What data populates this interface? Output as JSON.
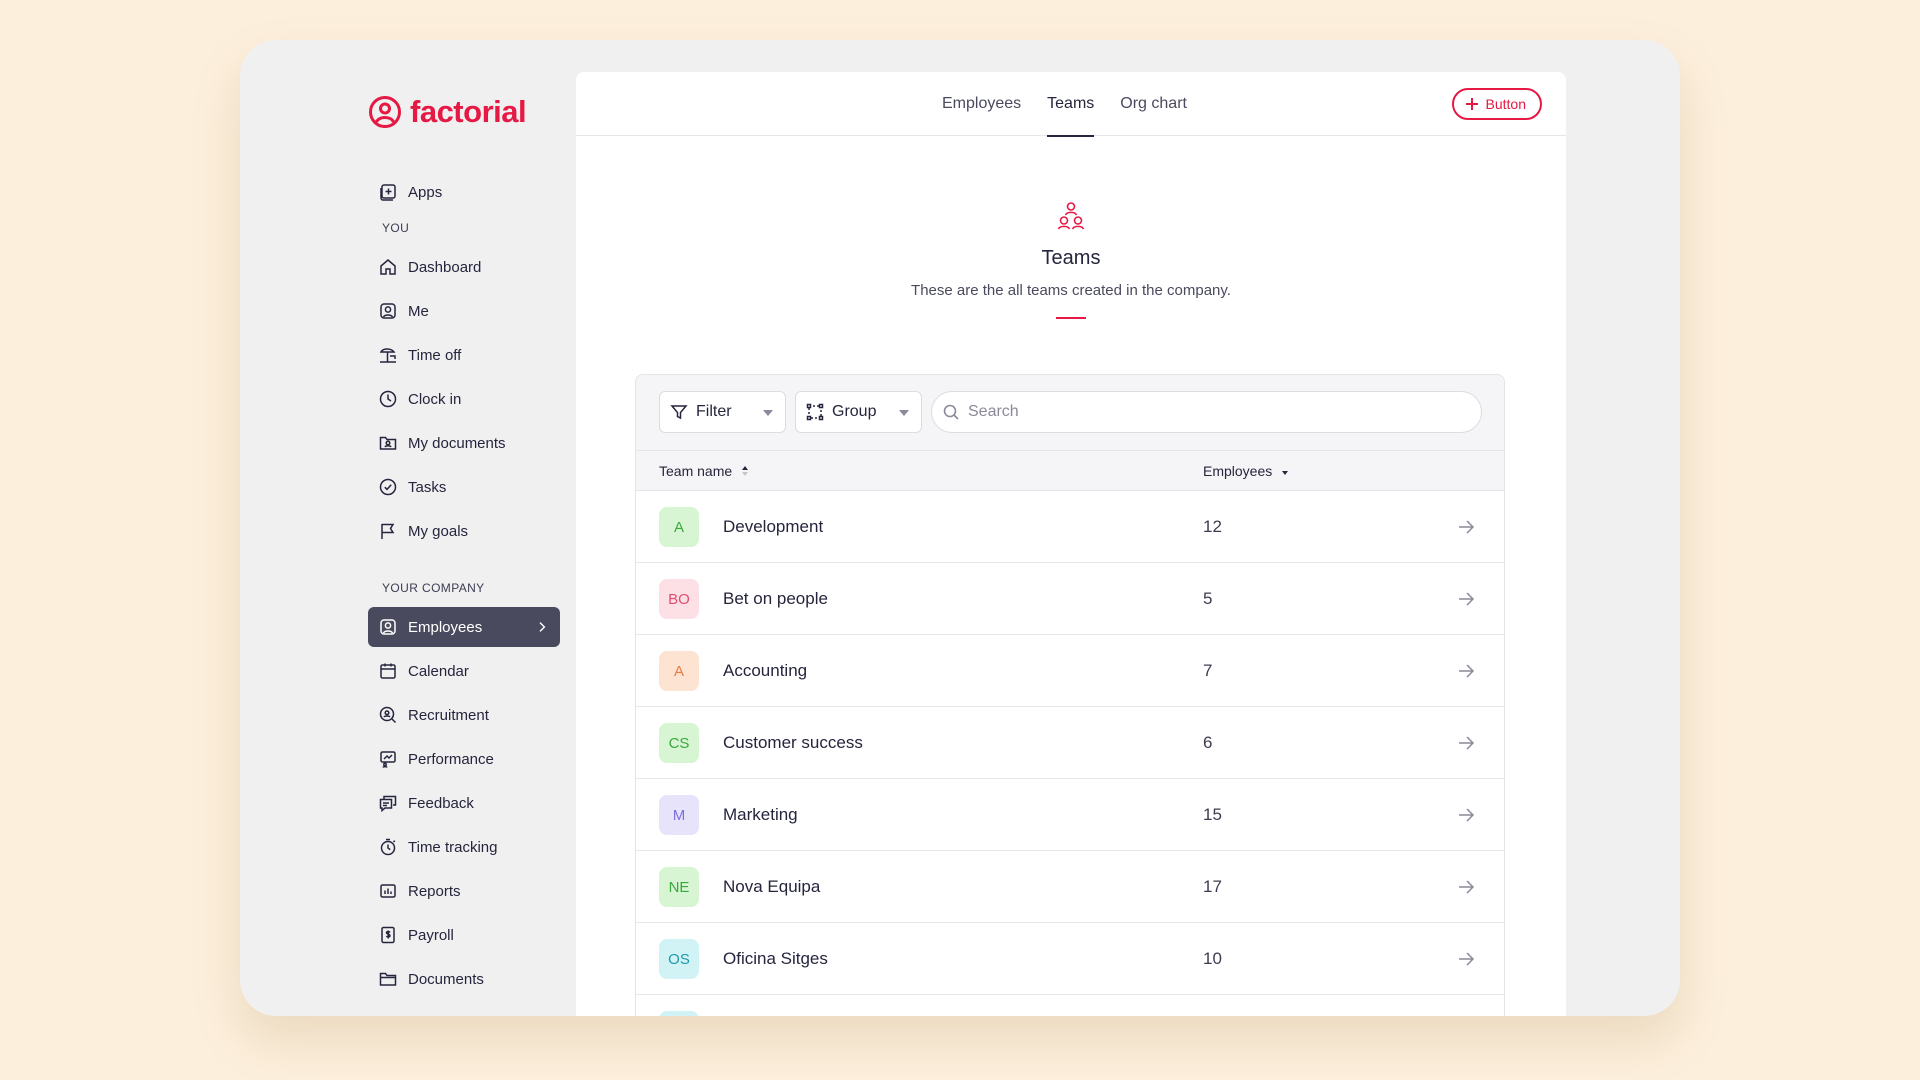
{
  "brand": {
    "name": "factorial",
    "color": "#e51943"
  },
  "sidebar": {
    "top_item": {
      "label": "Apps",
      "icon": "apps-icon"
    },
    "section_you": "YOU",
    "you_items": [
      {
        "label": "Dashboard",
        "icon": "home-icon"
      },
      {
        "label": "Me",
        "icon": "user-icon"
      },
      {
        "label": "Time off",
        "icon": "beach-icon"
      },
      {
        "label": "Clock in",
        "icon": "clock-icon"
      },
      {
        "label": "My documents",
        "icon": "folder-user-icon"
      },
      {
        "label": "Tasks",
        "icon": "check-circle-icon"
      },
      {
        "label": "My goals",
        "icon": "flag-icon"
      }
    ],
    "section_company": "YOUR COMPANY",
    "company_items": [
      {
        "label": "Employees",
        "icon": "employees-icon",
        "active": true
      },
      {
        "label": "Calendar",
        "icon": "calendar-icon"
      },
      {
        "label": "Recruitment",
        "icon": "recruitment-icon"
      },
      {
        "label": "Performance",
        "icon": "performance-icon"
      },
      {
        "label": "Feedback",
        "icon": "feedback-icon"
      },
      {
        "label": "Time tracking",
        "icon": "stopwatch-icon"
      },
      {
        "label": "Reports",
        "icon": "reports-icon"
      },
      {
        "label": "Payroll",
        "icon": "payroll-icon"
      },
      {
        "label": "Documents",
        "icon": "documents-icon"
      }
    ]
  },
  "tabs": [
    {
      "label": "Employees",
      "active": false
    },
    {
      "label": "Teams",
      "active": true
    },
    {
      "label": "Org chart",
      "active": false
    }
  ],
  "top_button": {
    "label": "Button"
  },
  "hero": {
    "icon": "teams-icon",
    "title": "Teams",
    "subtitle": "These are the all teams created in the company."
  },
  "toolbar": {
    "filter_label": "Filter",
    "group_label": "Group",
    "search_placeholder": "Search"
  },
  "table": {
    "columns": {
      "team_name": "Team name",
      "employees": "Employees"
    },
    "rows": [
      {
        "initials": "A",
        "name": "Development",
        "count": "12",
        "bg": "#d7f5d3",
        "fg": "#3ca83c"
      },
      {
        "initials": "BO",
        "name": "Bet on people",
        "count": "5",
        "bg": "#fde0e6",
        "fg": "#e0506e"
      },
      {
        "initials": "A",
        "name": "Accounting",
        "count": "7",
        "bg": "#fde3d2",
        "fg": "#ea7b3e"
      },
      {
        "initials": "CS",
        "name": "Customer success",
        "count": "6",
        "bg": "#d7f5d3",
        "fg": "#3ca83c"
      },
      {
        "initials": "M",
        "name": "Marketing",
        "count": "15",
        "bg": "#e6e3fb",
        "fg": "#7d70d6"
      },
      {
        "initials": "NE",
        "name": "Nova Equipa",
        "count": "17",
        "bg": "#d7f5d3",
        "fg": "#3ca83c"
      },
      {
        "initials": "OS",
        "name": "Oficina Sitges",
        "count": "10",
        "bg": "#d2f3f6",
        "fg": "#1c9aa8"
      },
      {
        "initials": "",
        "name": "",
        "count": "",
        "bg": "#d2f3f6",
        "fg": "#1c9aa8"
      }
    ]
  }
}
